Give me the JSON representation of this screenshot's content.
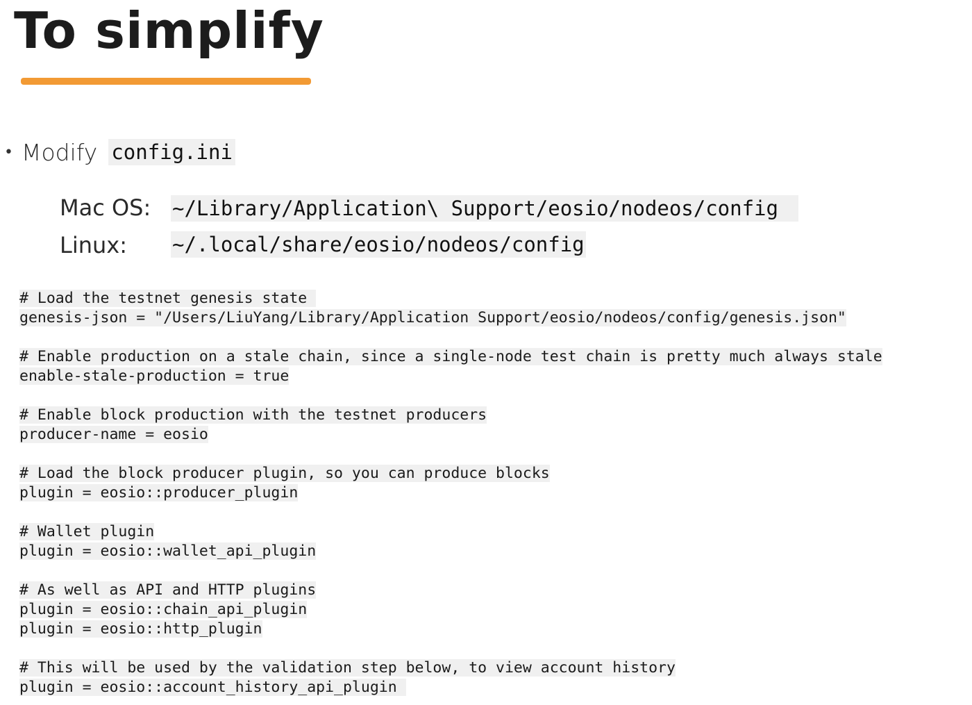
{
  "slide": {
    "title": "To simplify",
    "accent_color": "#f29a34",
    "bullet": {
      "text": "Modify",
      "code": "config.ini"
    },
    "paths": [
      {
        "label": "Mac OS:",
        "path": "~/Library/Application\\ Support/eosio/nodeos/config"
      },
      {
        "label": "Linux:",
        "path": "~/.local/share/eosio/nodeos/config"
      }
    ],
    "code": {
      "l0": "# Load the testnet genesis state ",
      "l1": "genesis-json = \"/Users/LiuYang/Library/Application Support/eosio/nodeos/config/genesis.json\"",
      "l3": "# Enable production on a stale chain, since a single-node test chain is pretty much always stale",
      "l4": "enable-stale-production = true",
      "l6": "# Enable block production with the testnet producers",
      "l7": "producer-name = eosio",
      "l9": "# Load the block producer plugin, so you can produce blocks",
      "l10": "plugin = eosio::producer_plugin",
      "l12": "# Wallet plugin",
      "l13": "plugin = eosio::wallet_api_plugin",
      "l15": "# As well as API and HTTP plugins",
      "l16": "plugin = eosio::chain_api_plugin",
      "l17": "plugin = eosio::http_plugin",
      "l19": "# This will be used by the validation step below, to view account history",
      "l20": "plugin = eosio::account_history_api_plugin "
    }
  }
}
